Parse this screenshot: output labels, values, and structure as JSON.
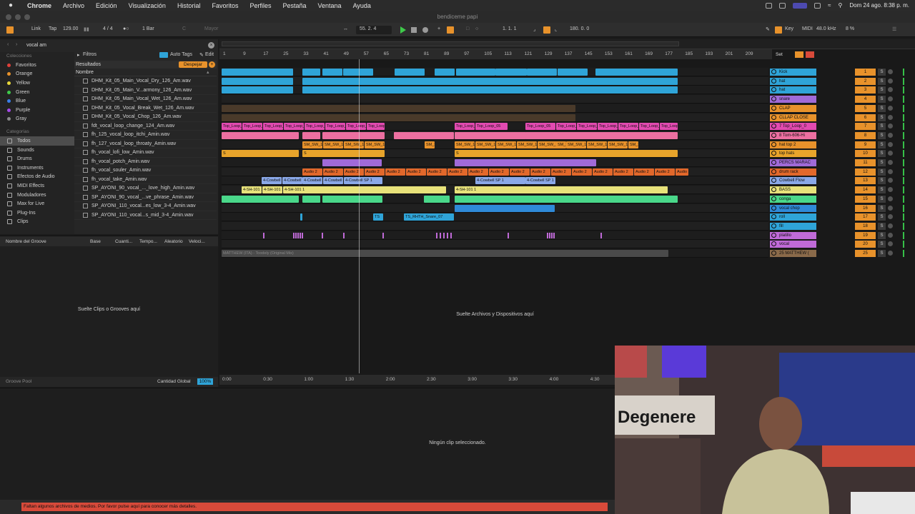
{
  "menubar": {
    "app": "Chrome",
    "items": [
      "Archivo",
      "Edición",
      "Visualización",
      "Historial",
      "Favoritos",
      "Perfiles",
      "Pestaña",
      "Ventana",
      "Ayuda"
    ],
    "datetime": "Dom 24 ago.  8:38 p. m."
  },
  "window": {
    "title": "bendiceme papi"
  },
  "transport": {
    "link": "Link",
    "tap": "Tap",
    "tempo": "129.00",
    "signature": "4 / 4",
    "quantize": "1 Bar",
    "key": "C",
    "scale": "Mayor",
    "position": "55.   2.   4",
    "loop_start": "1.   1.   1",
    "loop_length": "180.   0.   0",
    "key_btn": "Key",
    "midi_btn": "MIDI",
    "sample_rate": "48.0 kHz",
    "cpu": "8 %"
  },
  "browser": {
    "search": "vocal am",
    "filters": "Filtros",
    "auto_tags": "Auto Tags",
    "edit": "Edit",
    "results": "Resultados",
    "clear": "Despejar",
    "name_header": "Nombre",
    "collections_title": "Colecciones",
    "collections": [
      {
        "label": "Favoritos",
        "color": "#e0403a"
      },
      {
        "label": "Orange",
        "color": "#e8922b"
      },
      {
        "label": "Yellow",
        "color": "#e8d83a"
      },
      {
        "label": "Green",
        "color": "#3ec94a"
      },
      {
        "label": "Blue",
        "color": "#3a7ee8"
      },
      {
        "label": "Purple",
        "color": "#a54ae8"
      },
      {
        "label": "Gray",
        "color": "#8a8a8a"
      }
    ],
    "categories_title": "Categorías",
    "categories": [
      "Todos",
      "Sounds",
      "Drums",
      "Instruments",
      "Efectos de Audio",
      "MIDI Effects",
      "Moduladores",
      "Max for Live",
      "Plug-Ins",
      "Clips"
    ],
    "files": [
      "DHM_Kit_05_Main_Vocal_Dry_126_Am.wav",
      "DHM_Kit_05_Main_V...armony_126_Am.wav",
      "DHM_Kit_05_Main_Vocal_Wet_126_Am.wav",
      "DHM_Kit_05_Vocal_Break_Wet_126_Am.wav",
      "DHM_Kit_05_Vocal_Chop_126_Am.wav",
      "fdt_vocal_loop_change_124_Am.wav",
      "fh_125_vocal_loop_itchi_Amin.wav",
      "fh_127_vocal_loop_throaty_Amin.wav",
      "fh_vocal_lofi_low_Amin.wav",
      "fh_vocal_potch_Amin.wav",
      "fh_vocal_souler_Amin.wav",
      "fh_vocal_take_Amin.wav",
      "SP_AYONI_90_vocal_..._love_high_Amin.wav",
      "SP_AYONI_90_vocal_...ve_phrase_Amin.wav",
      "SP_AYONI_110_vocal...es_low_3-4_Amin.wav",
      "SP_AYONI_110_vocal...s_mid_3-4_Amin.wav"
    ]
  },
  "groove": {
    "headers": [
      "Nombre del Groove",
      "Base",
      "Cuanti...",
      "Tempo...",
      "Aleatorio",
      "Veloci..."
    ],
    "drop_hint": "Suelte Clips o Grooves aquí",
    "pool": "Groove Pool",
    "global_amount_label": "Cantidad Global",
    "global_amount": "100%"
  },
  "arrangement": {
    "set_label": "Set",
    "bars": [
      "1",
      "9",
      "17",
      "25",
      "33",
      "41",
      "49",
      "57",
      "65",
      "73",
      "81",
      "89",
      "97",
      "105",
      "113",
      "121",
      "129",
      "137",
      "145",
      "153",
      "161",
      "169",
      "177",
      "185",
      "193",
      "201",
      "209"
    ],
    "times": [
      "0:00",
      "0:30",
      "1:00",
      "1:30",
      "2:00",
      "2:30",
      "3:00",
      "3:30",
      "4:00",
      "4:30"
    ],
    "drop_hint": "Suelte Archivos y Dispositivos aquí",
    "clip_labels": {
      "top_loop": "Top_Loop_05",
      "sm": "SM_SW_130",
      "s": "S",
      "audio2": "Audio 2",
      "cowbell": "4-Cowbell SP 1",
      "sh101": "4-SH-101 1",
      "ts": "TS",
      "ts_snare": "TS_RHTH_Snare_07",
      "matthew": "MATTHEW (ITA) - Toodely (Original Mix)"
    }
  },
  "tracks": [
    {
      "name": "Kick",
      "num": "1",
      "color": "#2fa4d8"
    },
    {
      "name": "hat",
      "num": "2",
      "color": "#2fa4d8"
    },
    {
      "name": "hat",
      "num": "3",
      "color": "#2fa4d8"
    },
    {
      "name": "snare",
      "num": "4",
      "color": "#a06ad8"
    },
    {
      "name": "CLAP",
      "num": "5",
      "color": "#e8922b"
    },
    {
      "name": "CLLAP CLOSE",
      "num": "6",
      "color": "#e8922b"
    },
    {
      "name": "7 Top_Loop_0",
      "num": "7",
      "color": "#e24ab0"
    },
    {
      "name": "8 Tom-606-Hi",
      "num": "8",
      "color": "#ec6fa0"
    },
    {
      "name": "hat top 2",
      "num": "9",
      "color": "#e8922b"
    },
    {
      "name": "top hats",
      "num": "10",
      "color": "#e8a42b"
    },
    {
      "name": "PERCS MARAC",
      "num": "11",
      "color": "#a06ad8"
    },
    {
      "name": "drum rack",
      "num": "12",
      "color": "#e2682b"
    },
    {
      "name": "Cowbell Flow",
      "num": "13",
      "color": "#8aa8e8"
    },
    {
      "name": "BASS",
      "num": "14",
      "color": "#e8e27a"
    },
    {
      "name": "conga",
      "num": "15",
      "color": "#4ad88a"
    },
    {
      "name": "vocal chop",
      "num": "16",
      "color": "#2f8ad8"
    },
    {
      "name": "roll",
      "num": "17",
      "color": "#2fa4d8"
    },
    {
      "name": "fill",
      "num": "18",
      "color": "#2fa4d8"
    },
    {
      "name": "platillo",
      "num": "19",
      "color": "#c06ad8"
    },
    {
      "name": "vocal",
      "num": "20",
      "color": "#c06ad8"
    },
    {
      "name": "25 MATTHEW (",
      "num": "25",
      "color": "#8a6a4a"
    }
  ],
  "detail": {
    "empty": "Ningún clip seleccionado."
  },
  "status": {
    "message": "Faltan algunos archivos de medios. Por favor pulse aquí para conocer más detalles."
  },
  "webcam": {
    "sign": "Degenere"
  },
  "colors": {
    "accent": "#e8922b",
    "play": "#3ec94a",
    "warning": "#d84a3a"
  }
}
